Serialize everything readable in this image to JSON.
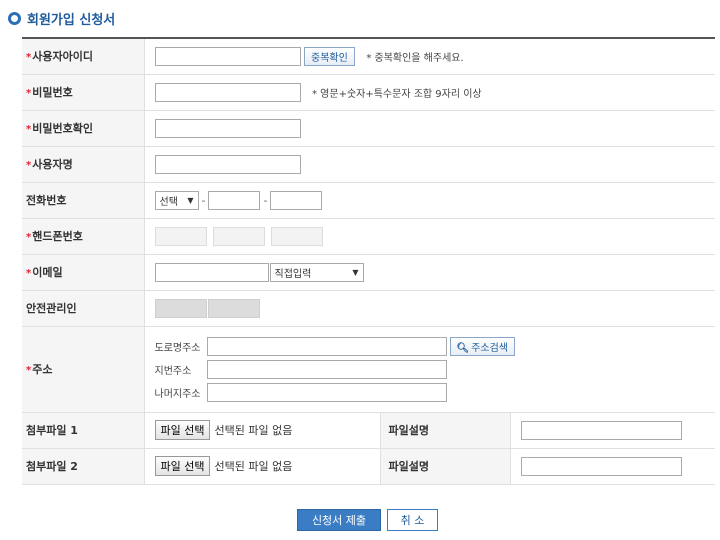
{
  "page_title": "회원가입 신청서",
  "required_mark": "*",
  "fields": {
    "user_id": {
      "label": "사용자아이디",
      "value": "",
      "check_button": "중복확인",
      "note": "* 중복확인을 해주세요."
    },
    "password": {
      "label": "비밀번호",
      "value": "",
      "note": "* 영문+숫자+특수문자 조합 9자리 이상"
    },
    "password_confirm": {
      "label": "비밀번호확인",
      "value": ""
    },
    "user_name": {
      "label": "사용자명"
    },
    "phone": {
      "label": "전화번호",
      "prefix_select": "선택",
      "dash": "-"
    },
    "mobile": {
      "label": "핸드폰번호"
    },
    "email": {
      "label": "이메일",
      "domain_select": "직접입력"
    },
    "safety_manager": {
      "label": "안전관리인"
    },
    "address": {
      "label": "주소",
      "road_label": "도로명주소",
      "lot_label": "지번주소",
      "rest_label": "나머지주소",
      "search_button": "주소검색"
    },
    "attach1": {
      "label": "첨부파일 1",
      "file_button": "파일 선택",
      "file_status": "선택된 파일 없음",
      "desc_label": "파일설명"
    },
    "attach2": {
      "label": "첨부파일 2",
      "file_button": "파일 선택",
      "file_status": "선택된 파일 없음",
      "desc_label": "파일설명"
    }
  },
  "actions": {
    "submit": "신청서 제출",
    "cancel": "취 소"
  },
  "colors": {
    "accent": "#3a7dc4",
    "title": "#1f5c9b",
    "required": "#dd2233"
  }
}
